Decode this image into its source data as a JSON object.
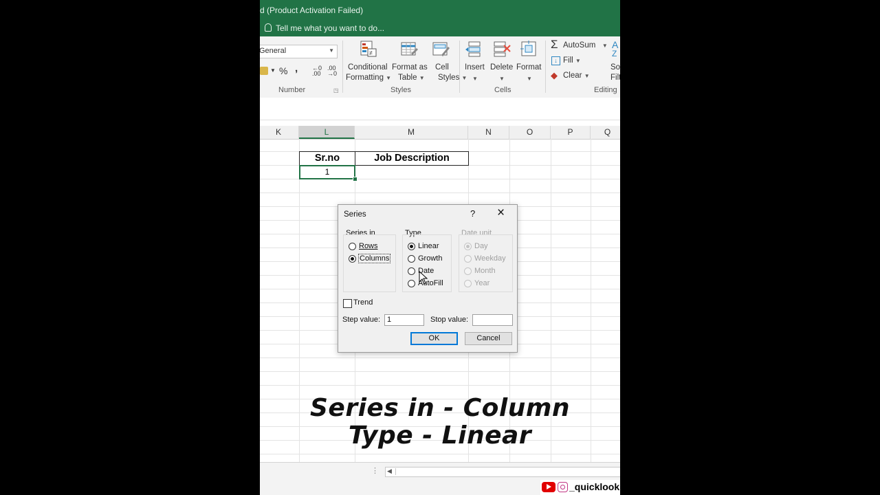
{
  "window": {
    "title": "d (Product Activation Failed)",
    "tell_me": "Tell me what you want to do...",
    "accent_color": "#217346"
  },
  "ribbon": {
    "number_format": "General",
    "number_group": "Number",
    "percent": "%",
    "comma": ",",
    "conditional_formatting": [
      "Conditional",
      "Formatting"
    ],
    "format_as_table": [
      "Format as",
      "Table"
    ],
    "cell_styles": [
      "Cell",
      "Styles"
    ],
    "styles_group": "Styles",
    "insert": "Insert",
    "delete": "Delete",
    "format": "Format",
    "cells_group": "Cells",
    "autosum": "AutoSum",
    "fill": "Fill",
    "clear": "Clear",
    "sort_a": "A",
    "sort_z": "Z",
    "sort_filter": [
      "Sor",
      "Filt"
    ],
    "editing_group": "Editing"
  },
  "columns": [
    "K",
    "L",
    "M",
    "N",
    "O",
    "P",
    "Q"
  ],
  "sheet": {
    "header_srno": "Sr.no",
    "header_job": "Job Description",
    "cell_l2": "1"
  },
  "dialog": {
    "title": "Series",
    "help": "?",
    "close": "×",
    "series_in_label": "Series in",
    "rows": "Rows",
    "columns": "Columns",
    "type_label": "Type",
    "linear": "Linear",
    "growth": "Growth",
    "date": "Date",
    "autofill": "AutoFill",
    "date_unit_label": "Date unit",
    "day": "Day",
    "weekday": "Weekday",
    "month": "Month",
    "year": "Year",
    "trend": "Trend",
    "step_value_label": "Step value:",
    "step_value": "1",
    "stop_value_label": "Stop value:",
    "stop_value": "",
    "ok": "OK",
    "cancel": "Cancel"
  },
  "caption": {
    "line1": "Series in - Column",
    "line2": "Type - Linear"
  },
  "watermark": {
    "handle": "_quicklook"
  }
}
